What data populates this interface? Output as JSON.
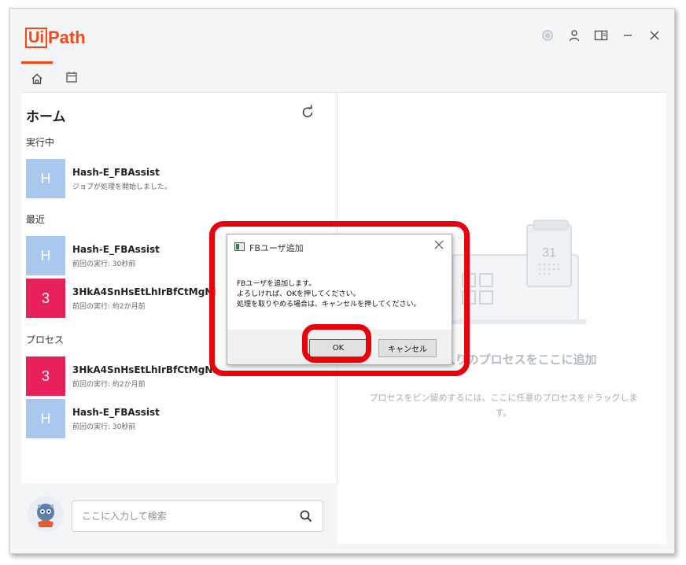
{
  "app": {
    "logo_ui": "Ui",
    "logo_path": "Path"
  },
  "window_controls": {
    "icons": [
      "status-icon",
      "user-icon",
      "panel-icon",
      "minimize-icon",
      "close-icon"
    ]
  },
  "tabs": [
    {
      "icon": "home-icon"
    },
    {
      "icon": "calendar-icon"
    }
  ],
  "left": {
    "title": "ホーム",
    "sections": {
      "running": "実行中",
      "recent": "最近",
      "process": "プロセス"
    },
    "running_items": [
      {
        "avatar": "H",
        "color": "#a8c8ee",
        "name": "Hash-E_FBAssist",
        "sub": "ジョブが処理を開始しました。"
      }
    ],
    "recent_items": [
      {
        "avatar": "H",
        "color": "#a8c8ee",
        "name": "Hash-E_FBAssist",
        "sub": "前回の実行: 30秒前"
      },
      {
        "avatar": "3",
        "color": "#e8215a",
        "name": "3HkA4SnHsEtLhIrBfCtMgNi",
        "sub": "前回の実行: 約2か月前"
      }
    ],
    "process_items": [
      {
        "avatar": "3",
        "color": "#e8215a",
        "name": "3HkA4SnHsEtLhIrBfCtMgNi",
        "sub": "前回の実行: 約2か月前"
      },
      {
        "avatar": "H",
        "color": "#a8c8ee",
        "name": "Hash-E_FBAssist",
        "sub": "前回の実行: 30秒前"
      }
    ],
    "search": {
      "placeholder": "ここに入力して検索"
    }
  },
  "right": {
    "calendar_day": "31",
    "fav_title": "お気に入りのプロセスをここに追加",
    "fav_desc": "プロセスをピン留めするには、ここに任意のプロセスをドラッグします。"
  },
  "dialog": {
    "title": "FBユーザ追加",
    "message": "FBユーザを追加します。\nよろしければ、OKを押してください。\n処理を取りやめる場合は、キャンセルを押してください。",
    "ok_label": "OK",
    "cancel_label": "キャンセル"
  },
  "colors": {
    "accent": "#fa4616",
    "highlight": "#e8000b"
  }
}
